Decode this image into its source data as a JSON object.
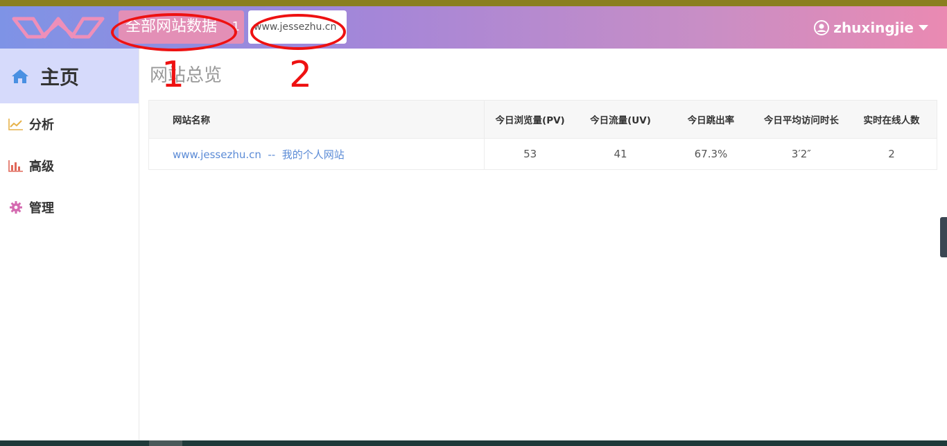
{
  "header": {
    "tab_all_label": "全部网站数据",
    "tab_all_count": "1",
    "tab_site_label": "www.jessezhu.cn",
    "username": "zhuxingjie"
  },
  "sidebar": {
    "home_label": "主页",
    "items": [
      {
        "label": "分析",
        "icon": "line-chart-icon"
      },
      {
        "label": "高级",
        "icon": "bar-chart-icon"
      },
      {
        "label": "管理",
        "icon": "gear-icon"
      }
    ]
  },
  "main": {
    "title": "网站总览",
    "table": {
      "headers": [
        "网站名称",
        "今日浏览量(PV)",
        "今日流量(UV)",
        "今日跳出率",
        "今日平均访问时长",
        "实时在线人数"
      ],
      "rows": [
        {
          "name": "www.jessezhu.cn  --  我的个人网站",
          "pv": "53",
          "uv": "41",
          "bounce": "67.3%",
          "avg_time": "3′2″",
          "online": "2"
        }
      ]
    }
  },
  "annotations": [
    "1",
    "2"
  ],
  "colors": {
    "header_start": "#7e93e6",
    "header_end": "#ea8ab2",
    "active_tab": "#e38fb6",
    "sidebar_active": "#d6dafb",
    "link": "#5b8bd6",
    "annotation": "#ee1111"
  }
}
